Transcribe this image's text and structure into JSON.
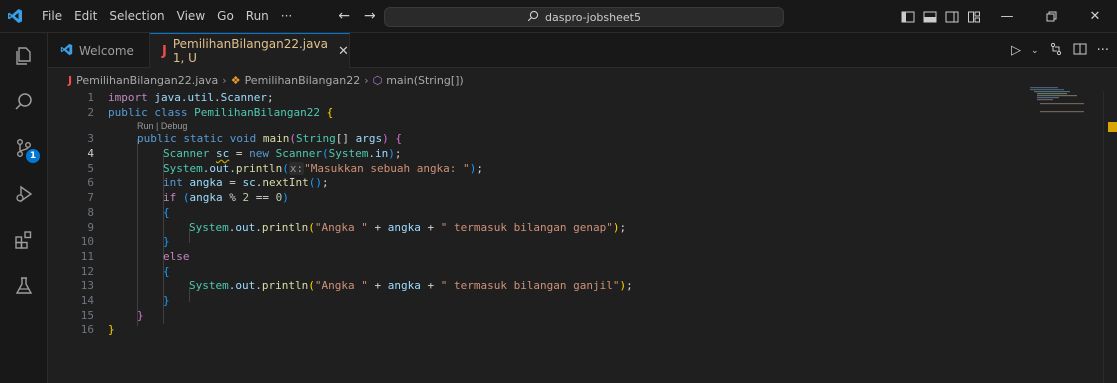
{
  "titlebar": {
    "menu": [
      "File",
      "Edit",
      "Selection",
      "View",
      "Go",
      "Run",
      "···"
    ],
    "search_text": "daspro-jobsheet5",
    "nav_back": "←",
    "nav_forward": "→"
  },
  "tabs": [
    {
      "label": "Welcome",
      "icon": "vscode-logo-icon"
    },
    {
      "label": "PemilihanBilangan22.java 1, U",
      "icon": "java-file-icon"
    }
  ],
  "breadcrumb": {
    "file": "PemilihanBilangan22.java",
    "class": "PemilihanBilangan22",
    "method": "main(String[])"
  },
  "codelens": "Run | Debug",
  "editor": {
    "current_line": 4,
    "line_numbers": [
      "1",
      "2",
      "3",
      "4",
      "5",
      "6",
      "7",
      "8",
      "9",
      "10",
      "11",
      "12",
      "13",
      "14",
      "15",
      "16"
    ],
    "tokens": {
      "l1_import": "import",
      "l1_pkg": "java.util.Scanner",
      "l1_semi": ";",
      "l2_public": "public",
      "l2_class": "class",
      "l2_name": "PemilihanBilangan22",
      "l2_brace": "{",
      "l3_public": "public",
      "l3_static": "static",
      "l3_void": "void",
      "l3_main": "main",
      "l3_open": "(",
      "l3_string": "String",
      "l3_arr": "[] ",
      "l3_args": "args",
      "l3_close": ")",
      "l3_brace": "{",
      "l4_scanner": "Scanner",
      "l4_sc": "sc",
      "l4_eq": " = ",
      "l4_new": "new",
      "l4_scanner2": "Scanner",
      "l4_open": "(",
      "l4_system": "System",
      "l4_in": ".in",
      "l4_close": ")",
      "l4_semi": ";",
      "l5_system": "System",
      "l5_out": ".out.",
      "l5_println": "println",
      "l5_open": "(",
      "l5_hint": "x:",
      "l5_str": "\"Masukkan sebuah angka: \"",
      "l5_close": ")",
      "l5_semi": ";",
      "l6_int": "int",
      "l6_angka": "angka",
      "l6_eq": " = ",
      "l6_sc": "sc",
      "l6_dot": ".",
      "l6_next": "nextInt",
      "l6_paren": "()",
      "l6_semi": ";",
      "l7_if": "if",
      "l7_open": "(",
      "l7_angka": "angka",
      "l7_op": " % ",
      "l7_two": "2",
      "l7_eqeq": " == ",
      "l7_zero": "0",
      "l7_close": ")",
      "l8_brace": "{",
      "l9_system": "System",
      "l9_out": ".out.",
      "l9_println": "println",
      "l9_open": "(",
      "l9_str1": "\"Angka \"",
      "l9_plus1": " + ",
      "l9_angka": "angka",
      "l9_plus2": " + ",
      "l9_str2": "\" termasuk bilangan genap\"",
      "l9_close": ")",
      "l9_semi": ";",
      "l10_brace": "}",
      "l11_else": "else",
      "l12_brace": "{",
      "l13_system": "System",
      "l13_out": ".out.",
      "l13_println": "println",
      "l13_open": "(",
      "l13_str1": "\"Angka \"",
      "l13_plus1": " + ",
      "l13_angka": "angka",
      "l13_plus2": " + ",
      "l13_str2": "\" termasuk bilangan ganjil\"",
      "l13_close": ")",
      "l13_semi": ";",
      "l14_brace": "}",
      "l15_brace": "}",
      "l16_brace": "}"
    }
  },
  "colors": {
    "accent": "#0078d4",
    "modified_tab": "#e2c08d",
    "java_icon": "#f14c4c",
    "warning": "#cca700"
  },
  "activity_badge": "1"
}
